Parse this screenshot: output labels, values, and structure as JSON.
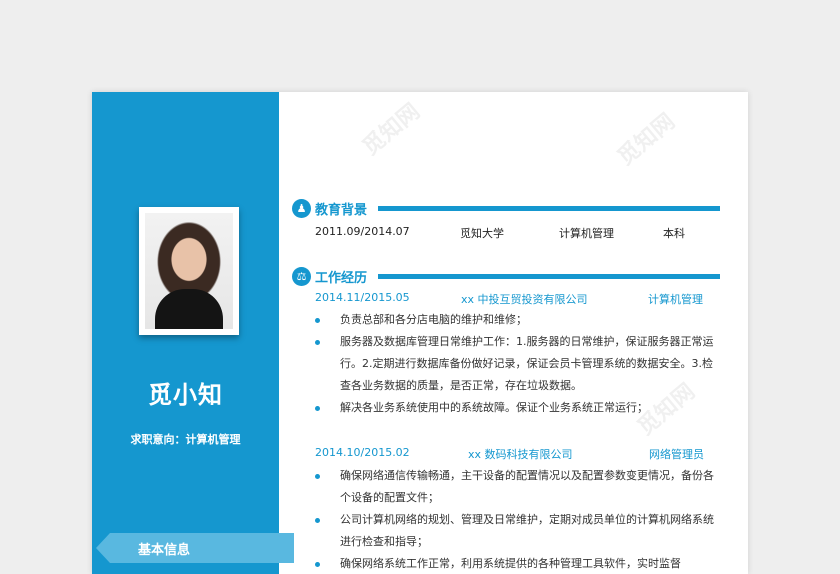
{
  "profile": {
    "name": "觅小知",
    "intent": "求职意向：计算机管理",
    "sidebar_tab": "基本信息"
  },
  "education": {
    "title": "教育背景",
    "row": {
      "period": "2011.09/2014.07",
      "school": "觅知大学",
      "major": "计算机管理",
      "degree": "本科"
    }
  },
  "work": {
    "title": "工作经历",
    "jobs": [
      {
        "period": "2014.11/2015.05",
        "company": "xx 中投互贸投资有限公司",
        "position": "计算机管理",
        "duties": [
          "负责总部和各分店电脑的维护和维修；",
          "服务器及数据库管理日常维护工作：1.服务器的日常维护，保证服务器正常运行。2.定期进行数据库备份做好记录，保证会员卡管理系统的数据安全。3.检查各业务数据的质量，是否正常，存在垃圾数据。",
          "解决各业务系统使用中的系统故障。保证个业务系统正常运行；"
        ]
      },
      {
        "period": "2014.10/2015.02",
        "company": "xx 数码科技有限公司",
        "position": "网络管理员",
        "duties": [
          "确保网络通信传输畅通，主干设备的配置情况以及配置参数变更情况，备份各个设备的配置文件；",
          "公司计算机网络的规划、管理及日常维护，定期对成员单位的计算机网络系统进行检查和指导；",
          "确保网络系统工作正常，利用系统提供的各种管理工具软件，实时监督"
        ]
      }
    ]
  },
  "watermark": "觅知网",
  "colors": {
    "accent": "#1597cf",
    "tab": "#59b8e0"
  },
  "icons": {
    "education": "people-icon",
    "work": "balance-icon"
  }
}
